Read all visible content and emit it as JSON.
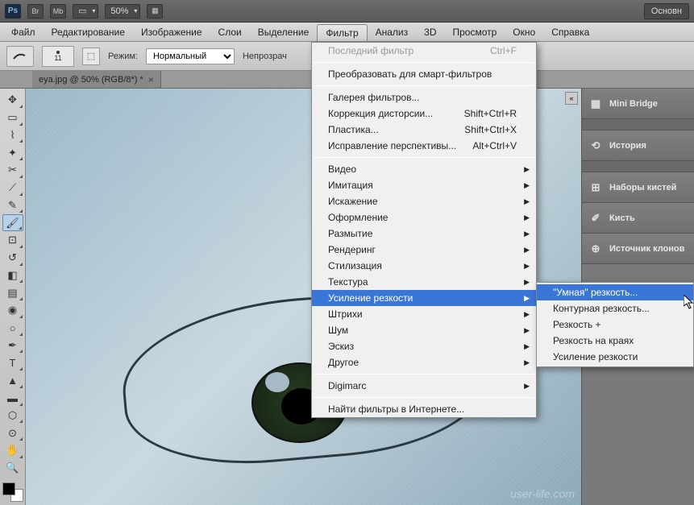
{
  "titlebar": {
    "logo": "Ps",
    "br": "Br",
    "mb": "Mb",
    "zoom": "50%",
    "essentials": "Основн"
  },
  "menubar": {
    "file": "Файл",
    "edit": "Редактирование",
    "image": "Изображение",
    "layers": "Слои",
    "select": "Выделение",
    "filter": "Фильтр",
    "analysis": "Анализ",
    "threed": "3D",
    "view": "Просмотр",
    "window": "Окно",
    "help": "Справка"
  },
  "options": {
    "brush_size": "11",
    "mode_label": "Режим:",
    "mode_value": "Нормальный",
    "opacity_label": "Непрозрач"
  },
  "tab": {
    "title": "eya.jpg @ 50% (RGB/8*) *"
  },
  "panels": {
    "mini_bridge": "Mini Bridge",
    "history": "История",
    "brush_presets": "Наборы кистей",
    "brush": "Кисть",
    "clone_source": "Источник клонов"
  },
  "filter_menu": {
    "last_filter": "Последний фильтр",
    "last_filter_key": "Ctrl+F",
    "convert_smart": "Преобразовать для смарт-фильтров",
    "filter_gallery": "Галерея фильтров...",
    "lens_correction": "Коррекция дисторсии...",
    "lens_key": "Shift+Ctrl+R",
    "liquify": "Пластика...",
    "liquify_key": "Shift+Ctrl+X",
    "vanishing": "Исправление перспективы...",
    "vanishing_key": "Alt+Ctrl+V",
    "video": "Видео",
    "artistic": "Имитация",
    "distort": "Искажение",
    "decor": "Оформление",
    "blur": "Размытие",
    "render": "Рендеринг",
    "stylize": "Стилизация",
    "texture": "Текстура",
    "sharpen": "Усиление резкости",
    "strokes": "Штрихи",
    "noise": "Шум",
    "sketch": "Эскиз",
    "other": "Другое",
    "digimarc": "Digimarc",
    "browse_online": "Найти фильтры в Интернете..."
  },
  "sharpen_submenu": {
    "smart": "\"Умная\" резкость...",
    "unsharp": "Контурная резкость...",
    "sharpen_plus": "Резкость +",
    "sharpen_edges": "Резкость на краях",
    "sharpen_basic": "Усиление резкости"
  },
  "watermark": "user-life.com"
}
